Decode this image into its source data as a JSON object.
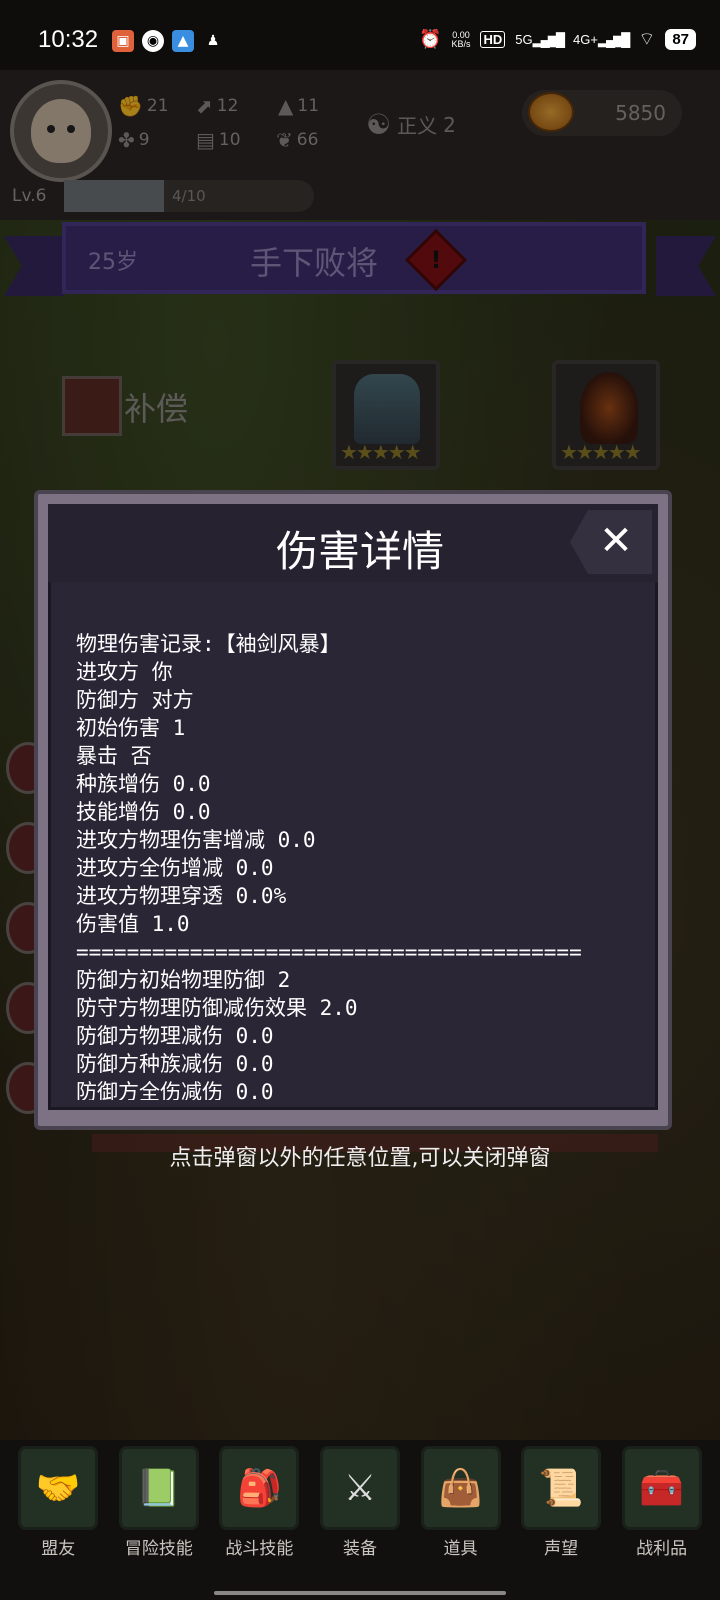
{
  "status_bar": {
    "time": "10:32",
    "net_speed": "0.00\nKB/s",
    "hd": "HD",
    "net1": "5G",
    "net2": "4G+",
    "battery": "87"
  },
  "player": {
    "stats": [
      {
        "icon": "fist-icon",
        "value": "21"
      },
      {
        "icon": "boot-icon",
        "value": "12"
      },
      {
        "icon": "wizard-hat-icon",
        "value": "11"
      },
      {
        "icon": "clover-icon",
        "value": "9"
      },
      {
        "icon": "scroll-icon",
        "value": "10"
      },
      {
        "icon": "wings-icon",
        "value": "66"
      }
    ],
    "alignment_label": "正义",
    "alignment_value": "2",
    "coins": "5850",
    "level": "Lv.6",
    "xp_text": "4/10",
    "xp_fraction": 0.4
  },
  "banner": {
    "age": "25岁",
    "title": "手下败将"
  },
  "compensation_label": "补偿",
  "modal": {
    "title": "伤害详情",
    "lines": [
      "物理伤害记录:【袖剑风暴】",
      "进攻方 你",
      "防御方 对方",
      "初始伤害 1",
      "暴击 否",
      "种族增伤 0.0",
      "技能增伤 0.0",
      "进攻方物理伤害增减 0.0",
      "进攻方全伤增减 0.0",
      "进攻方物理穿透 0.0%",
      "伤害值 1.0",
      "========================================",
      "防御方初始物理防御 2",
      "防守方物理防御减伤效果 2.0",
      "防御方物理减伤 0.0",
      "防御方种族减伤 0.0",
      "防御方全伤减伤 0.0"
    ]
  },
  "hint": "点击弹窗以外的任意位置,可以关闭弹窗",
  "nav": [
    {
      "label": "盟友",
      "icon": "handshake-icon"
    },
    {
      "label": "冒险技能",
      "icon": "book-icon"
    },
    {
      "label": "战斗技能",
      "icon": "backpack-icon"
    },
    {
      "label": "装备",
      "icon": "crossed-swords-icon"
    },
    {
      "label": "道具",
      "icon": "bag-icon"
    },
    {
      "label": "声望",
      "icon": "scroll-icon"
    },
    {
      "label": "战利品",
      "icon": "treasure-chest-icon"
    }
  ]
}
